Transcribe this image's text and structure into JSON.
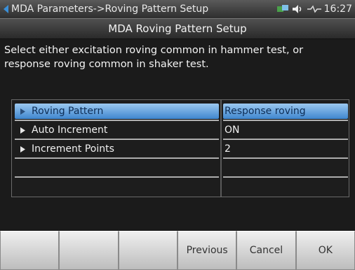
{
  "titlebar": {
    "title": "MDA Parameters->Roving Pattern Setup",
    "clock": "16:27",
    "icons": [
      "back-arrow-icon",
      "network-icon",
      "volume-icon",
      "signal-icon"
    ]
  },
  "subheader": {
    "title": "MDA Roving Pattern Setup"
  },
  "description": "Select either excitation roving  common in hammer test, or response roving common in shaker test.",
  "table": {
    "rows": [
      {
        "label": "Roving Pattern",
        "value": "Response roving",
        "selected": true
      },
      {
        "label": "Auto Increment",
        "value": "ON",
        "selected": false
      },
      {
        "label": "Increment Points",
        "value": "2",
        "selected": false
      },
      {
        "label": "",
        "value": "",
        "selected": false
      },
      {
        "label": "",
        "value": "",
        "selected": false
      }
    ]
  },
  "toolbar": {
    "buttons": [
      "",
      "",
      "",
      "Previous",
      "Cancel",
      "OK"
    ]
  },
  "colors": {
    "selection": "#5a9be0",
    "background": "#1b1b1b",
    "toolbar": "#d8d8d8"
  }
}
